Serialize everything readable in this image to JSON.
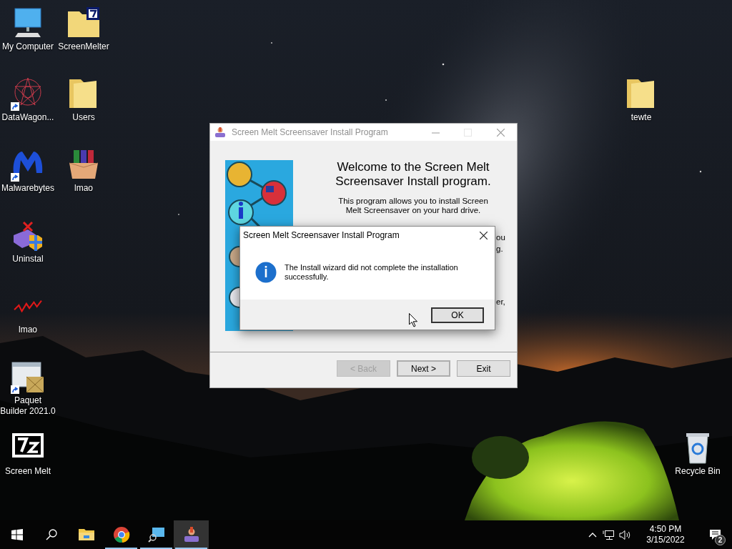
{
  "desktop": {
    "icons": [
      {
        "label": "My Computer",
        "shortcut": false
      },
      {
        "label": "ScreenMelter",
        "shortcut": false
      },
      {
        "label": "DataWagon...",
        "shortcut": true
      },
      {
        "label": "Users",
        "shortcut": false
      },
      {
        "label": "tewte",
        "shortcut": false
      },
      {
        "label": "Malwarebytes",
        "shortcut": true
      },
      {
        "label": "lmao",
        "shortcut": false
      },
      {
        "label": "Uninstal",
        "shortcut": false
      },
      {
        "label": "lmao",
        "shortcut": false
      },
      {
        "label": "Paquet Builder 2021.0",
        "shortcut": true
      },
      {
        "label": "Screen Melt",
        "shortcut": false
      },
      {
        "label": "Recycle Bin",
        "shortcut": false
      }
    ]
  },
  "installer_window": {
    "title": "Screen Melt Screensaver Install Program",
    "heading": "Welcome to the Screen Melt Screensaver Install program.",
    "intro": "This program allows you to install Screen Melt Screensaver on your hard drive.",
    "covered_text_fragments": [
      "ou",
      "g.",
      "er,"
    ],
    "buttons": [
      {
        "label": "< Back",
        "disabled": true
      },
      {
        "label": "Next >",
        "disabled": false
      },
      {
        "label": "Exit",
        "disabled": false
      }
    ]
  },
  "message_dialog": {
    "title": "Screen Melt Screensaver Install Program",
    "message": "The Install wizard did not complete the installation successfully.",
    "button": "OK"
  },
  "taskbar": {
    "apps": [
      {
        "running": false,
        "selected": false
      },
      {
        "running": true,
        "selected": false
      },
      {
        "running": true,
        "selected": false
      },
      {
        "running": true,
        "selected": true
      }
    ],
    "time": "4:50 PM",
    "date": "3/15/2022",
    "notification_count": "2"
  }
}
